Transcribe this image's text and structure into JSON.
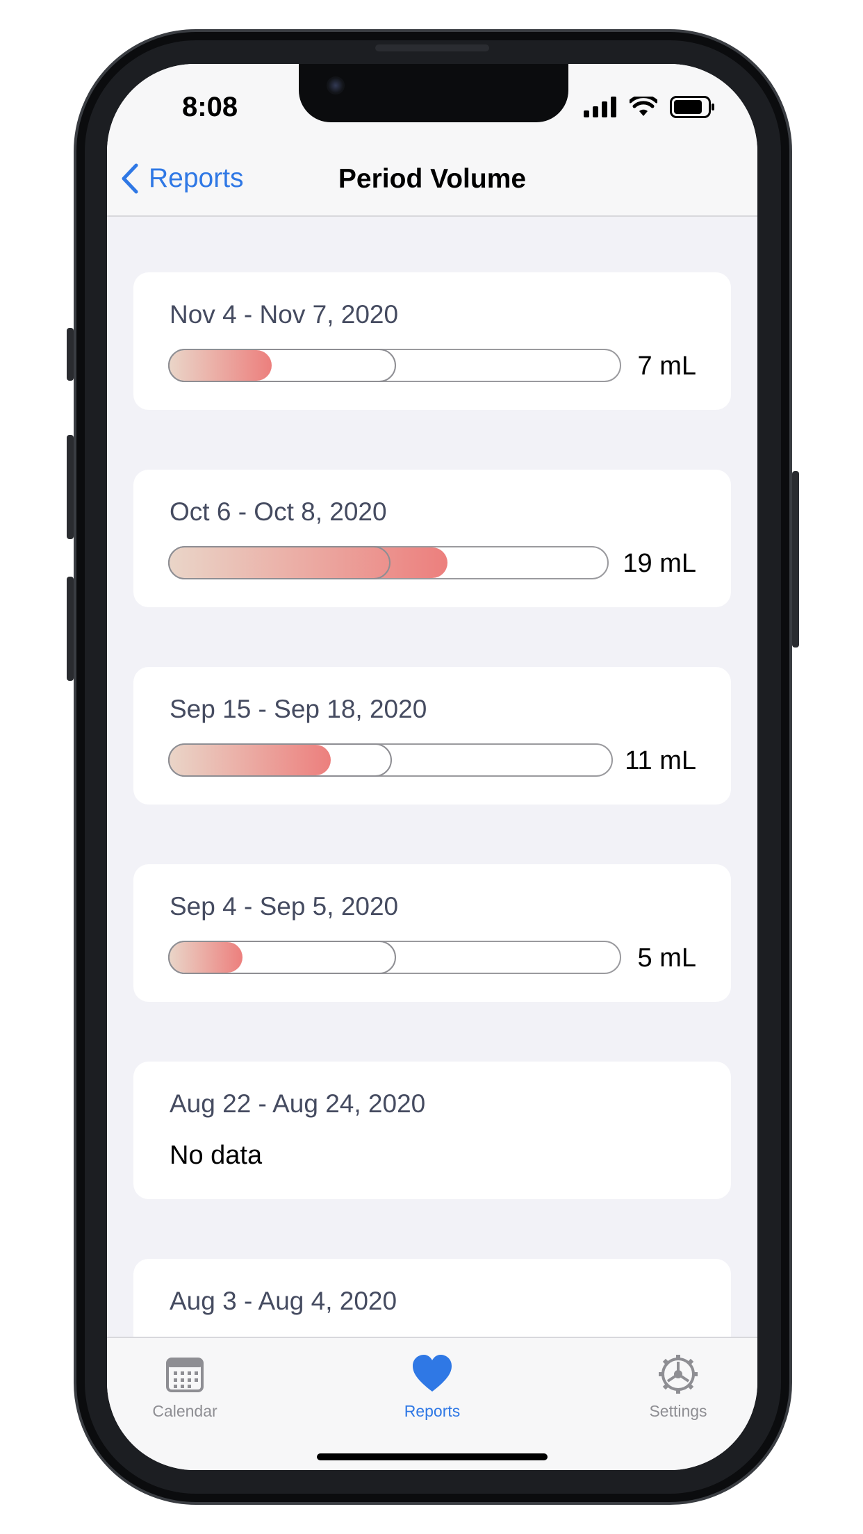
{
  "status_bar": {
    "time": "8:08"
  },
  "nav": {
    "back_label": "Reports",
    "title": "Period Volume"
  },
  "periods": [
    {
      "range": "Nov 4 - Nov 7, 2020",
      "volume_label": "7 mL",
      "volume_ml": 7
    },
    {
      "range": "Oct 6 - Oct 8, 2020",
      "volume_label": "19 mL",
      "volume_ml": 19
    },
    {
      "range": "Sep 15 - Sep 18, 2020",
      "volume_label": "11 mL",
      "volume_ml": 11
    },
    {
      "range": "Sep 4 - Sep 5, 2020",
      "volume_label": "5 mL",
      "volume_ml": 5
    },
    {
      "range": "Aug 22 - Aug 24, 2020",
      "volume_label": "No data"
    },
    {
      "range": "Aug 3 - Aug 4, 2020"
    }
  ],
  "tabs": [
    {
      "label": "Calendar",
      "icon": "calendar-icon"
    },
    {
      "label": "Reports",
      "icon": "heart-icon",
      "active": true
    },
    {
      "label": "Settings",
      "icon": "gear-icon"
    }
  ],
  "colors": {
    "accent": "#2f78e5",
    "bar_start": "#ead5c8",
    "bar_end": "#ec7f7d"
  }
}
